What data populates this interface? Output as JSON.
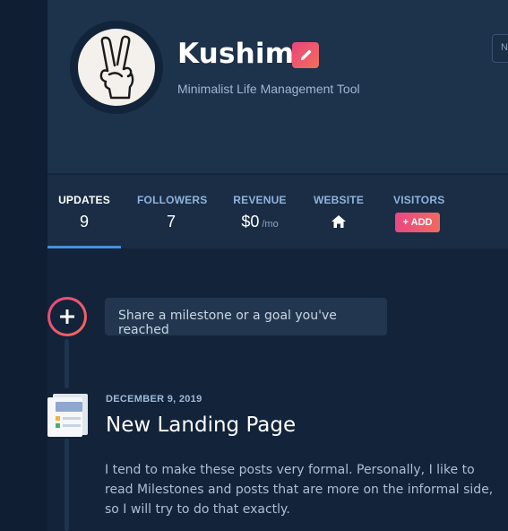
{
  "project": {
    "name": "Kushim",
    "tagline": "Minimalist Life Management Tool",
    "corner_button_label": "N"
  },
  "stats": {
    "updates": {
      "label": "UPDATES",
      "value": "9"
    },
    "followers": {
      "label": "FOLLOWERS",
      "value": "7"
    },
    "revenue": {
      "label": "REVENUE",
      "value": "$0",
      "unit": "/mo"
    },
    "website": {
      "label": "WEBSITE",
      "icon": "home-icon"
    },
    "visitors": {
      "label": "VISITORS",
      "add_label": "+ ADD"
    }
  },
  "composer": {
    "placeholder": "Share a milestone or a goal you've reached"
  },
  "post": {
    "date": "DECEMBER 9, 2019",
    "title": "New Landing Page",
    "body": "I tend to make these posts very formal. Personally, I like to read Milestones and posts that are more on the informal side, so I will try to do that exactly."
  },
  "colors": {
    "background": "#12233a",
    "header": "#1d324b",
    "accent_gradient_start": "#e9457c",
    "accent_gradient_end": "#f16f5a",
    "active_tab_underline": "#4a90d9"
  }
}
